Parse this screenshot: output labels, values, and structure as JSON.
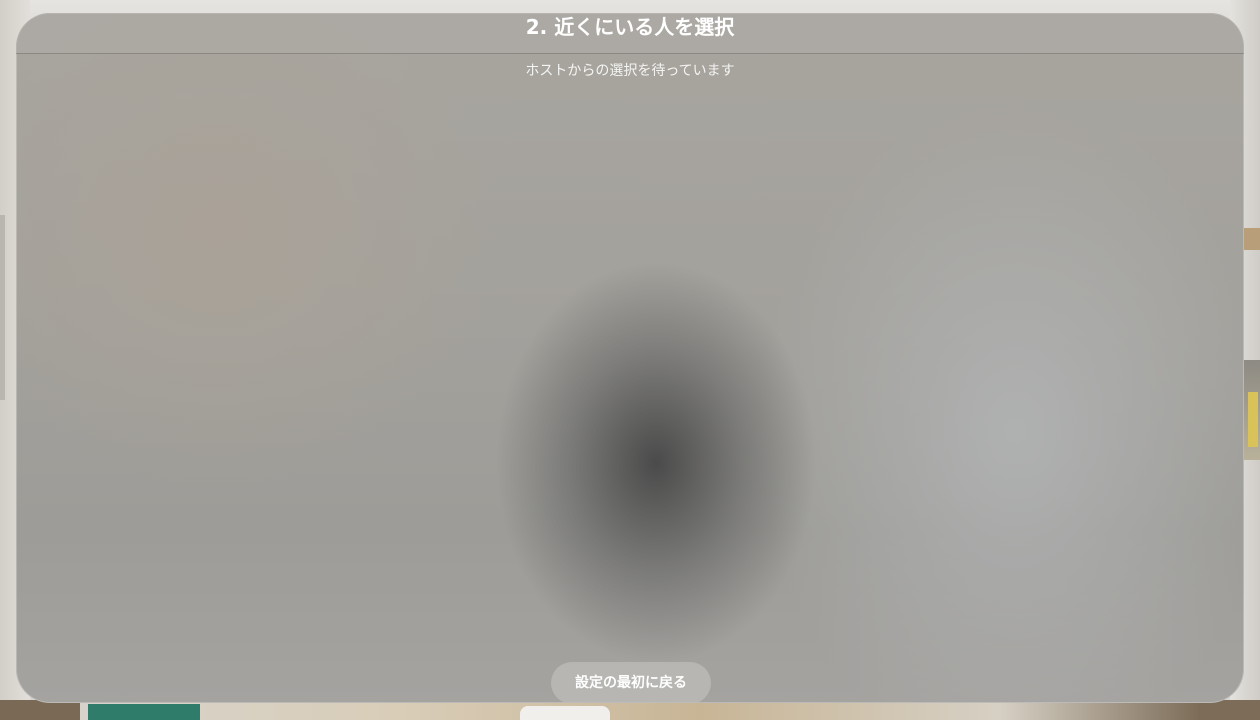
{
  "window": {
    "title": "2. 近くにいる人を選択",
    "status_message": "ホストからの選択を待っています"
  },
  "actions": {
    "back_to_setup_start_label": "設定の最初に戻る"
  }
}
